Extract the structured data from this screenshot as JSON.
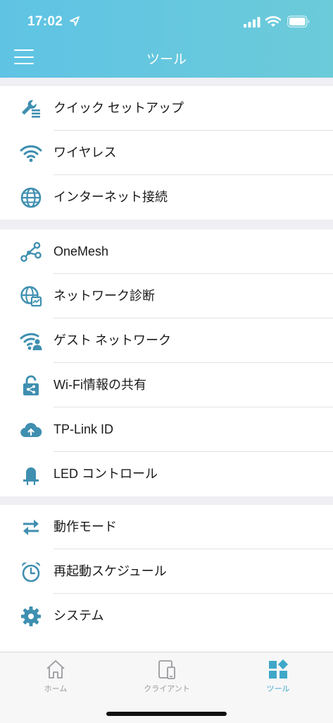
{
  "status_bar": {
    "time": "17:02"
  },
  "header": {
    "title": "ツール"
  },
  "sections": [
    [
      {
        "id": "quick-setup",
        "label": "クイック セットアップ",
        "icon": "wrench-list-icon"
      },
      {
        "id": "wireless",
        "label": "ワイヤレス",
        "icon": "wifi-icon"
      },
      {
        "id": "internet-connection",
        "label": "インターネット接続",
        "icon": "globe-icon"
      }
    ],
    [
      {
        "id": "onemesh",
        "label": "OneMesh",
        "icon": "mesh-nodes-icon"
      },
      {
        "id": "network-diagnostics",
        "label": "ネットワーク診断",
        "icon": "globe-diagnose-icon"
      },
      {
        "id": "guest-network",
        "label": "ゲスト ネットワーク",
        "icon": "wifi-guest-icon"
      },
      {
        "id": "wifi-share",
        "label": "Wi-Fi情報の共有",
        "icon": "share-lock-icon"
      },
      {
        "id": "tp-link-id",
        "label": "TP-Link ID",
        "icon": "cloud-upload-icon"
      },
      {
        "id": "led-control",
        "label": "LED コントロール",
        "icon": "led-lamp-icon"
      }
    ],
    [
      {
        "id": "operation-mode",
        "label": "動作モード",
        "icon": "swap-arrows-icon"
      },
      {
        "id": "reboot-schedule",
        "label": "再起動スケジュール",
        "icon": "alarm-clock-icon"
      },
      {
        "id": "system",
        "label": "システム",
        "icon": "gear-icon"
      }
    ]
  ],
  "tabbar": {
    "home": "ホーム",
    "clients": "クライアント",
    "tools": "ツール"
  },
  "colors": {
    "accent": "#3f8fb0",
    "header": "#63c6e0",
    "active_tab": "#3fa8c8"
  }
}
